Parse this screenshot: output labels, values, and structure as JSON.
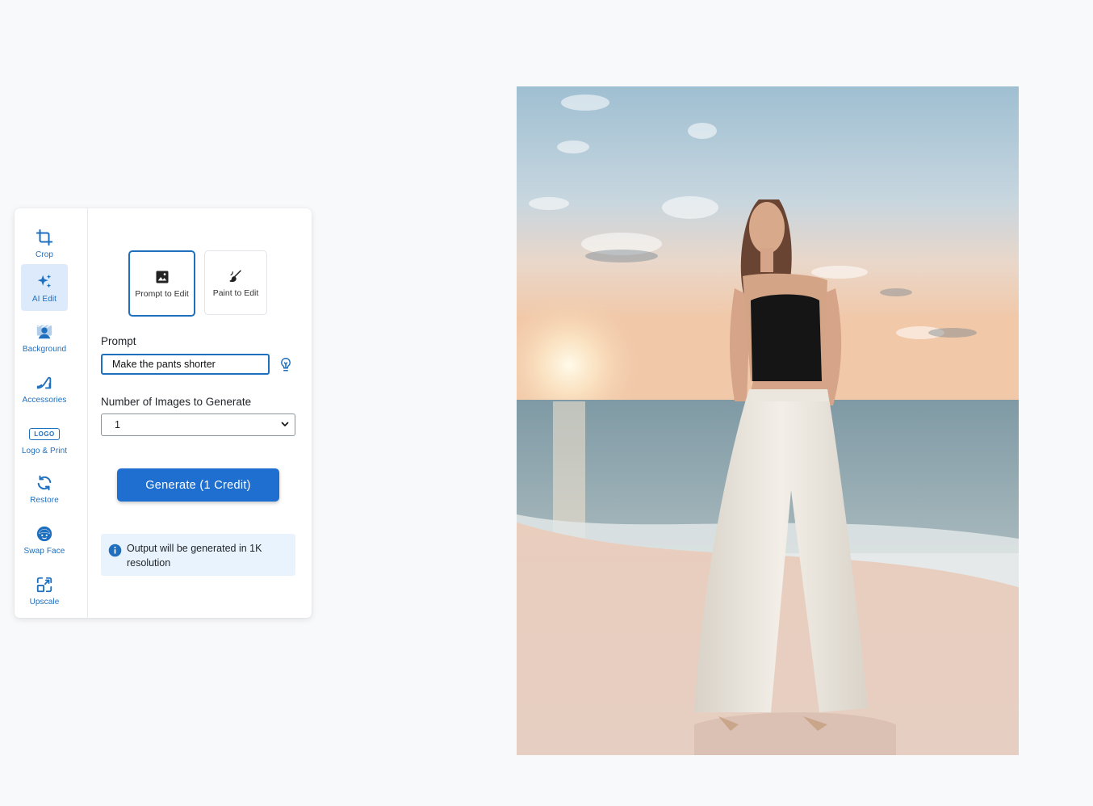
{
  "sidebar": {
    "items": [
      {
        "label": "Crop",
        "icon": "crop-icon"
      },
      {
        "label": "AI Edit",
        "icon": "sparkles-icon",
        "active": true
      },
      {
        "label": "Background",
        "icon": "background-icon"
      },
      {
        "label": "Accessories",
        "icon": "high-heel-icon"
      },
      {
        "label": "Logo & Print",
        "icon": "logo-icon",
        "logo_text": "LOGO"
      },
      {
        "label": "Restore",
        "icon": "restore-icon"
      },
      {
        "label": "Swap Face",
        "icon": "face-icon"
      },
      {
        "label": "Upscale",
        "icon": "upscale-icon"
      }
    ]
  },
  "modes": [
    {
      "label": "Prompt to Edit",
      "icon": "image-icon",
      "active": true
    },
    {
      "label": "Paint to Edit",
      "icon": "brush-icon",
      "active": false
    }
  ],
  "prompt": {
    "label": "Prompt",
    "value": "Make the pants shorter"
  },
  "count": {
    "label": "Number of Images to Generate",
    "selected": "1"
  },
  "generate": {
    "label": "Generate (1 Credit)"
  },
  "info": {
    "text": "Output will be generated in 1K resolution"
  },
  "colors": {
    "accent": "#1f6fd0",
    "active_bg": "#dceafb",
    "info_bg": "#e8f3fd",
    "page_bg": "#f8f9fb"
  }
}
